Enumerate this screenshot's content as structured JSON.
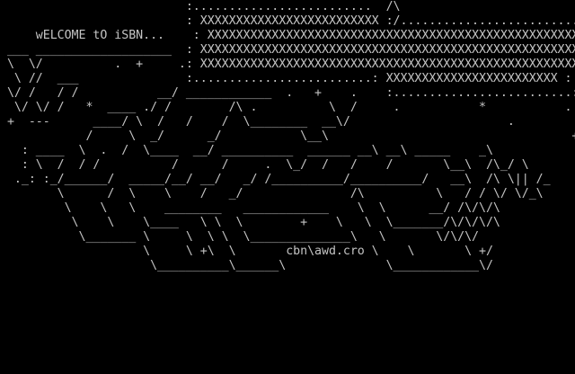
{
  "colors": {
    "background": "#000000",
    "text": "#c4c4c4"
  },
  "welcome_text": "wELCOME tO iSBN...",
  "signature": "cbn\\awd.cro",
  "art": [
    "                          :.........................  /\\",
    "                          : XXXXXXXXXXXXXXXXXXXXXXXXX :/..........................",
    "     wELCOME tO iSBN...    : XXXXXXXXXXXXXXXXXXXXXXXXXXXXXXXXXXXXXXXXXXXXXXXXXXXXX :",
    " ___ ___________________  : XXXXXXXXXXXXXXXXXXXXXXXXXXXXXXXXXXXXXXXXXXXXXXXXXXXXX :",
    " \\  \\/          .  +     .: XXXXXXXXXXXXXXXXXXXXXXXXXXXXXXXXXXXXXXXXXXXXXXXXXXXXX :",
    "  \\ //  ___               :.........................: XXXXXXXXXXXXXXXXXXXXXXXX :",
    " \\/ /   / /           __/ ____________  .   +    .    :.........................:",
    "  \\/ \\/ /   *  ____ ./ /        /\\ .          \\  /     .           *           .",
    " +  ---      ____/ \\  /   /    /  \\________  __\\/                      .",
    "            /     \\  _/      _/           \\__\\                                  +",
    "   : ____  \\  .  /  \\____  __/ __________  ______ __\\ __\\ _____    _\\            /\\",
    "   : \\  /  / /          /      /     .  \\_/  /   /    /       \\__\\  /\\_/ \\",
    "  ._: :_/______/  _____/__/ __/   _/ /__________/__________/   __\\  /\\ \\|| /_",
    "        \\      /  \\    \\    /   _/               /\\          \\   / / \\/ \\/_\\",
    "         \\    \\   \\    ________   ____________    \\  \\      __/ /\\/\\/\\",
    "          \\    \\    \\____   \\ \\  \\        +    \\   \\  \\_______/\\/\\/\\/\\",
    "           \\_______ \\     \\  \\ \\  \\______________\\   \\       \\/\\/\\/",
    "                    \\     \\ +\\  \\       cbn\\awd.cro \\    \\       \\ +/",
    "                     \\__________\\______\\              \\____________\\/"
  ]
}
